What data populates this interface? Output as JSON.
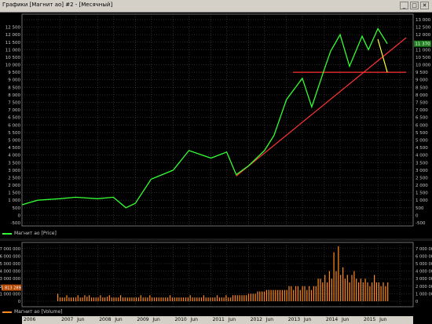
{
  "window": {
    "title": "Графики [Магнит ао] #2 - [Месячный]",
    "buttons": [
      "_",
      "□",
      "✕"
    ]
  },
  "price_pane": {
    "legend": "Магнит ао [Price]",
    "line_color": "#33ff33",
    "y_ticks_left": [
      "12 500",
      "12 000",
      "11 500",
      "11 000",
      "10 500",
      "10 000",
      "9 500",
      "9 000",
      "8 500",
      "8 000",
      "7 500",
      "7 000",
      "6 500",
      "6 000",
      "5 500",
      "5 000",
      "4 500",
      "4 000",
      "3 500",
      "3 000",
      "2 500",
      "2 000",
      "1 500",
      "1 000",
      "500",
      "0",
      "-500"
    ],
    "y_ticks_right": [
      "13 000",
      "12 500",
      "12 000",
      "11 500",
      "11 000",
      "10 500",
      "10 000",
      "9 500",
      "9 000",
      "8 500",
      "8 000",
      "7 500",
      "7 000",
      "6 500",
      "6 000",
      "5 500",
      "5 000",
      "4 500",
      "4 000",
      "3 500",
      "3 000",
      "2 500",
      "2 000",
      "1 500",
      "1 000",
      "500",
      "0",
      "-500"
    ],
    "last_value": "11 370"
  },
  "volume_pane": {
    "legend": "Магнит ао [Volume]",
    "bar_color": "#ff8c1a",
    "y_ticks_left": [
      "7 000 000",
      "6 000 000",
      "5 000 000",
      "4 000 000",
      "3 000 000",
      "2 000 000",
      "1 000 000",
      "0"
    ],
    "y_ticks_right": [
      "7 000 000",
      "6 000 000",
      "5 000 000",
      "4 000 000",
      "3 000 000",
      "2 000 000",
      "1 000 000",
      "0"
    ],
    "last_value": "1 813 289"
  },
  "time_axis": {
    "labels": [
      "2006",
      "2007",
      "Jun",
      "2008",
      "Jun",
      "2009",
      "Jun",
      "2010",
      "Jun",
      "2011",
      "Jun",
      "2012",
      "Jun",
      "2013",
      "Jun",
      "2014",
      "Jun",
      "2015",
      "Jun"
    ]
  },
  "chart_data": [
    {
      "type": "line",
      "title": "Магнит ао [Price]",
      "x": [
        "2006-01",
        "2006-06",
        "2007-01",
        "2007-06",
        "2008-01",
        "2008-06",
        "2008-10",
        "2009-01",
        "2009-06",
        "2010-01",
        "2010-06",
        "2011-01",
        "2011-06",
        "2011-09",
        "2012-01",
        "2012-06",
        "2012-09",
        "2013-01",
        "2013-06",
        "2013-09",
        "2014-01",
        "2014-03",
        "2014-06",
        "2014-09",
        "2015-01",
        "2015-03",
        "2015-06",
        "2015-09"
      ],
      "series": [
        {
          "name": "Магнит ао [Price]",
          "values": [
            700,
            1000,
            1100,
            1200,
            1100,
            1200,
            500,
            800,
            2400,
            3000,
            4300,
            3800,
            4200,
            2700,
            3300,
            4300,
            5300,
            7700,
            9100,
            7200,
            9700,
            10900,
            12000,
            9900,
            11900,
            11000,
            12400,
            11400
          ]
        }
      ],
      "ylim": [
        -500,
        13000
      ],
      "trendlines": [
        {
          "color": "#ff3333",
          "from": [
            "2011-09",
            2600
          ],
          "to": [
            "2016-03",
            11800
          ]
        },
        {
          "color": "#ff3333",
          "from": [
            "2013-03",
            9500
          ],
          "to": [
            "2016-03",
            9500
          ]
        },
        {
          "color": "#ffff33",
          "from": [
            "2015-06",
            11700
          ],
          "to": [
            "2015-09",
            9500
          ]
        }
      ]
    },
    {
      "type": "bar",
      "title": "Магнит ао [Volume]",
      "x_range": [
        "2006-01",
        "2015-09"
      ],
      "ylim": [
        0,
        7500000
      ],
      "values": [
        1,
        0.5,
        0.5,
        0.5,
        0.8,
        0.5,
        0.5,
        0.5,
        0.5,
        0.8,
        0.5,
        0.5,
        0.8,
        0.6,
        0.8,
        0.5,
        0.5,
        0.5,
        0.5,
        0.8,
        0.5,
        0.5,
        0.6,
        0.8,
        0.5,
        0.5,
        0.5,
        0.5,
        0.8,
        0.5,
        0.5,
        0.5,
        0.5,
        0.5,
        0.5,
        0.5,
        0.5,
        0.8,
        0.5,
        0.5,
        0.5,
        0.8,
        0.5,
        0.5,
        0.5,
        0.5,
        0.5,
        0.5,
        0.5,
        0.5,
        0.8,
        0.5,
        0.5,
        0.5,
        0.5,
        0.5,
        0.5,
        0.5,
        0.5,
        0.8,
        0.5,
        0.5,
        0.5,
        0.5,
        0.5,
        0.8,
        0.5,
        0.5,
        0.5,
        0.5,
        0.5,
        0.8,
        0.5,
        0.5,
        0.5,
        0.8,
        0.5,
        0.5,
        0.8,
        0.8,
        0.8,
        0.8,
        0.8,
        0.8,
        0.8,
        1.0,
        1.0,
        1.0,
        1.0,
        1.3,
        1.3,
        1.3,
        1.3,
        1.5,
        1.5,
        1.5,
        1.5,
        1.5,
        1.5,
        1.5,
        1.5,
        1.5,
        1.5,
        2.0,
        2.0,
        1.5,
        2.0,
        2.0,
        1.5,
        2.0,
        2.0,
        1.5,
        2.0,
        1.5,
        2.0,
        2.0,
        3.0,
        3.0,
        2.5,
        3.5,
        2.5,
        4.0,
        3.0,
        6.5,
        4.0,
        7.3,
        3.5,
        4.5,
        3.0,
        3.5,
        2.5,
        3.5,
        4.0,
        3.0,
        2.5,
        3.0,
        2.5,
        3.0,
        2.5,
        2.0,
        2.5,
        3.5,
        2.5,
        2.5,
        2.0,
        2.5,
        2.0,
        2.5
      ]
    }
  ]
}
